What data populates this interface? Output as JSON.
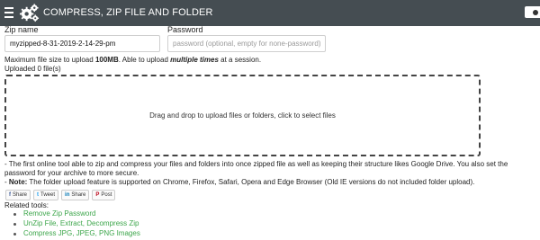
{
  "header": {
    "title": "COMPRESS, ZIP FILE AND FOLDER",
    "menu_icon": "hamburger-icon",
    "logo_icon": "gears-icon",
    "corner_button_label": "Do",
    "background": "#454d52"
  },
  "form": {
    "zip_label": "Zip name",
    "zip_value": "myzipped-8-31-2019-2-14-29-pm",
    "password_label": "Password",
    "password_placeholder": "password (optional, empty for none-password)"
  },
  "limits": {
    "prefix": "Maximum file size to upload ",
    "size": "100MB",
    "middle": ". Able to upload ",
    "emphasis": "multiple times",
    "suffix": " at a session."
  },
  "uploaded_count": "Uploaded 0 file(s)",
  "dropzone_text": "Drag and drop to upload files or folders, click to select files",
  "description": {
    "line1": "- The first online tool able to zip and compress your files and folders into once zipped file as well as keeping their structure likes Google Drive. You also set the",
    "line2": "password for your archive to more secure.",
    "note_prefix": "- ",
    "note_label": "Note:",
    "note_text": " The folder upload feature is supported on Chrome, Firefox, Safari, Opera and Edge Browser (Old IE versions do not included folder upload)."
  },
  "share": [
    {
      "icon": "facebook-icon",
      "glyph": "f",
      "label": "Share"
    },
    {
      "icon": "twitter-icon",
      "glyph": "t",
      "label": "Tweet"
    },
    {
      "icon": "linkedin-icon",
      "glyph": "in",
      "label": "Share"
    },
    {
      "icon": "pinterest-icon",
      "glyph": "P",
      "label": "Post"
    }
  ],
  "related": {
    "title": "Related tools:",
    "links": [
      "Remove Zip Password",
      "UnZip File, Extract, Decompress Zip",
      "Compress JPG, JPEG, PNG Images"
    ],
    "link_color": "#3da64b"
  }
}
